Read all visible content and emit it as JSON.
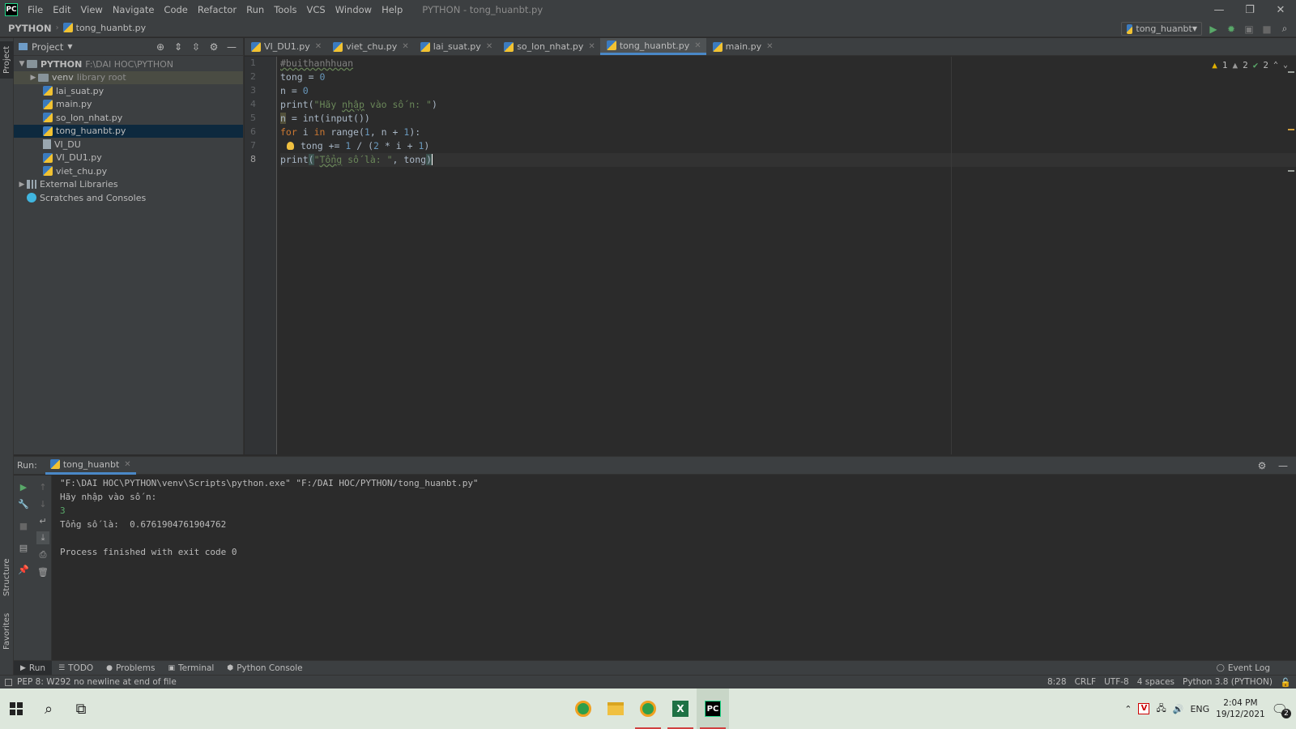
{
  "titlebar": {
    "logo": "PC",
    "menu": [
      "File",
      "Edit",
      "View",
      "Navigate",
      "Code",
      "Refactor",
      "Run",
      "Tools",
      "VCS",
      "Window",
      "Help"
    ],
    "window_title": "PYTHON - tong_huanbt.py",
    "controls": {
      "minimize": "—",
      "restore": "❐",
      "close": "✕"
    }
  },
  "navbar": {
    "project": "PYTHON",
    "file": "tong_huanbt.py",
    "run_config": "tong_huanbt"
  },
  "left_strip": {
    "project_tab": "Project",
    "structure_tab": "Structure",
    "favorites_tab": "Favorites"
  },
  "project_panel": {
    "title": "Project",
    "tree": [
      {
        "label": "PYTHON",
        "hint": "F:\\DAI HOC\\PYTHON",
        "type": "root"
      },
      {
        "label": "venv",
        "hint": "library root",
        "type": "folder"
      },
      {
        "label": "lai_suat.py",
        "type": "py"
      },
      {
        "label": "main.py",
        "type": "py"
      },
      {
        "label": "so_lon_nhat.py",
        "type": "py"
      },
      {
        "label": "tong_huanbt.py",
        "type": "py",
        "selected": true
      },
      {
        "label": "VI_DU",
        "type": "file"
      },
      {
        "label": "VI_DU1.py",
        "type": "py"
      },
      {
        "label": "viet_chu.py",
        "type": "py"
      },
      {
        "label": "External Libraries",
        "type": "lib"
      },
      {
        "label": "Scratches and Consoles",
        "type": "scratch"
      }
    ]
  },
  "editor_tabs": [
    {
      "label": "VI_DU1.py",
      "active": false
    },
    {
      "label": "viet_chu.py",
      "active": false
    },
    {
      "label": "lai_suat.py",
      "active": false
    },
    {
      "label": "so_lon_nhat.py",
      "active": false
    },
    {
      "label": "tong_huanbt.py",
      "active": true
    },
    {
      "label": "main.py",
      "active": false
    }
  ],
  "editor": {
    "line_numbers": [
      "1",
      "2",
      "3",
      "4",
      "5",
      "6",
      "7",
      "8"
    ],
    "current_line": 8,
    "code": {
      "l1": "#buithanhhuan",
      "l2_a": "tong = ",
      "l2_b": "0",
      "l3_a": "n = ",
      "l3_b": "0",
      "l4_a": "print(",
      "l4_b": "\"Hãy ",
      "l4_c": "nhập",
      "l4_d": " vào số n: \"",
      "l4_e": ")",
      "l5_a": "n",
      "l5_b": " = int(input())",
      "l6_a": "for",
      "l6_b": " i ",
      "l6_c": "in",
      "l6_d": " range(",
      "l6_e": "1",
      "l6_f": ", n + ",
      "l6_g": "1",
      "l6_h": "):",
      "l7_a": "tong += ",
      "l7_b": "1",
      "l7_c": " / (",
      "l7_d": "2",
      "l7_e": " * i + ",
      "l7_f": "1",
      "l7_g": ")",
      "l8_a": "print",
      "l8_b": "(",
      "l8_c": "\"",
      "l8_d": "Tổng",
      "l8_e": " số là: \"",
      "l8_f": ", tong",
      "l8_g": ")"
    },
    "inspections": {
      "warnings": "1",
      "weak_warnings": "2",
      "typos": "2"
    }
  },
  "run_panel": {
    "label": "Run:",
    "tab": "tong_huanbt",
    "console": [
      "\"F:\\DAI HOC\\PYTHON\\venv\\Scripts\\python.exe\" \"F:/DAI HOC/PYTHON/tong_huanbt.py\"",
      "Hãy nhập vào số n:",
      "3",
      "Tổng số là:  0.6761904761904762",
      "",
      "Process finished with exit code 0"
    ]
  },
  "bottom_tabs": [
    "Run",
    "TODO",
    "Problems",
    "Terminal",
    "Python Console"
  ],
  "event_log": "Event Log",
  "statusbar": {
    "message": "PEP 8: W292 no newline at end of file",
    "position": "8:28",
    "line_sep": "CRLF",
    "encoding": "UTF-8",
    "indent": "4 spaces",
    "interpreter": "Python 3.8 (PYTHON)"
  },
  "taskbar": {
    "language": "ENG",
    "time": "2:04 PM",
    "date": "19/12/2021",
    "notifications": "2"
  },
  "colors": {
    "accent": "#4a88c7",
    "keyword": "#cc7832",
    "number": "#6897bb",
    "string": "#6a8759"
  }
}
